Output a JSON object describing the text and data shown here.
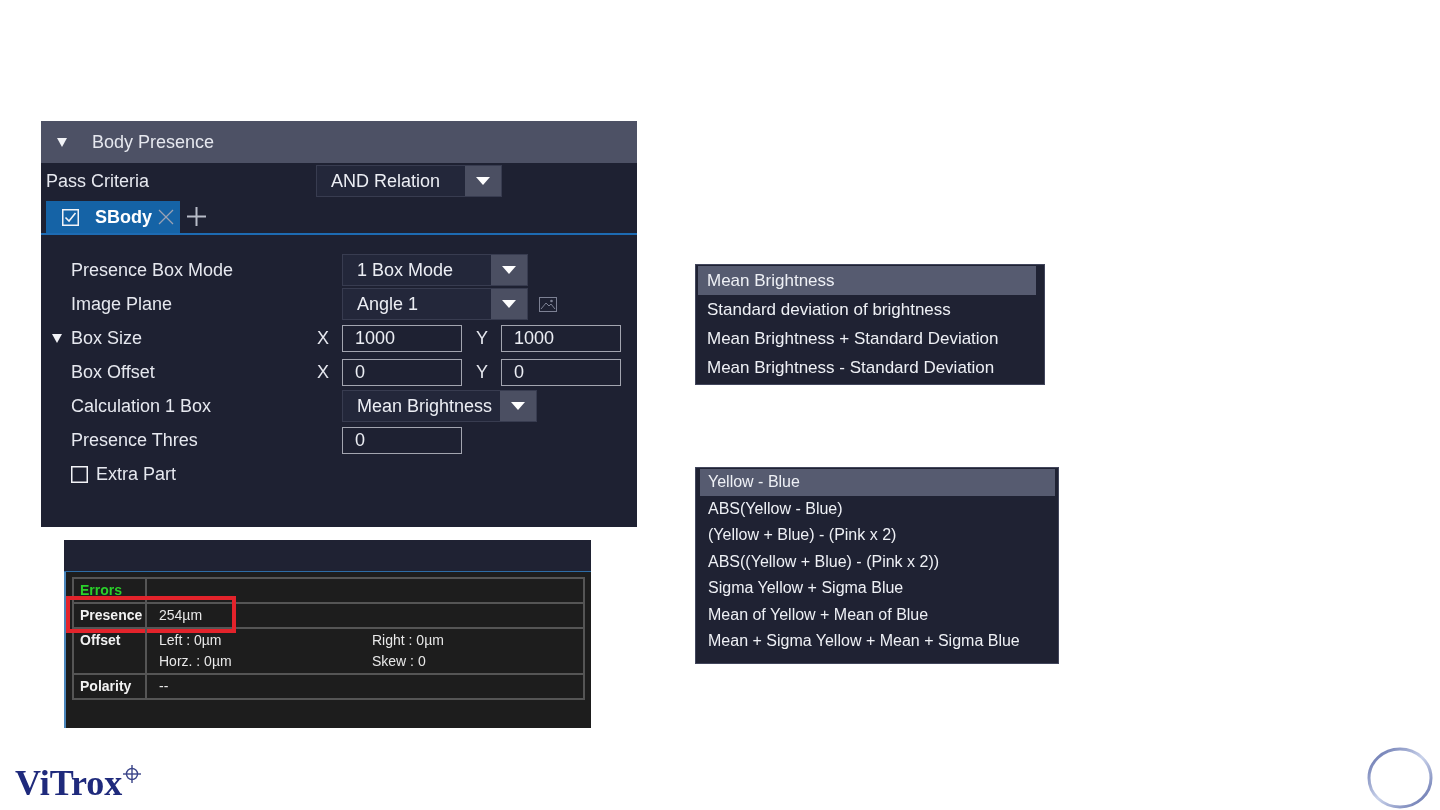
{
  "body_presence": {
    "title": "Body Presence",
    "expanded": true,
    "pass_criteria": {
      "label": "Pass Criteria",
      "value": "AND Relation"
    },
    "tabs": [
      {
        "label": "SBody",
        "checked": true,
        "selected": true
      }
    ],
    "properties": [
      {
        "kind": "dropdown",
        "label": "Presence Box Mode",
        "value": "1 Box Mode"
      },
      {
        "kind": "imagedropdown",
        "label": "Image Plane",
        "value": "Angle 1"
      },
      {
        "kind": "pair",
        "label": "Box Size",
        "expanded": true,
        "fields": [
          {
            "axis": "X",
            "value": "1000"
          },
          {
            "axis": "Y",
            "value": "1000"
          }
        ]
      },
      {
        "kind": "pair",
        "label": "Box Offset",
        "fields": [
          {
            "axis": "X",
            "value": "0"
          },
          {
            "axis": "Y",
            "value": "0"
          }
        ]
      },
      {
        "kind": "dropdown",
        "label": "Calculation 1 Box",
        "value": "Mean Brightness"
      },
      {
        "kind": "input",
        "label": "Presence Thres",
        "value": "0"
      },
      {
        "kind": "checkbox",
        "label": "Extra Part",
        "checked": false
      }
    ]
  },
  "results": {
    "rows": [
      {
        "kind": "error",
        "label": "Errors",
        "highlighted": false
      },
      {
        "kind": "normal",
        "label": "Presence",
        "highlighted": true,
        "values": [
          "254µm"
        ]
      },
      {
        "kind": "normal",
        "label": "Offset",
        "highlighted": false,
        "values": [
          "Left : 0µm",
          "Right : 0µm",
          "Horz. : 0µm",
          "Skew : 0"
        ]
      },
      {
        "kind": "normal",
        "label": "Polarity",
        "highlighted": false,
        "values": [
          "--"
        ]
      }
    ]
  },
  "brightness_menu": {
    "items": [
      {
        "label": "Mean Brightness",
        "selected": true
      },
      {
        "label": "Standard deviation of brightness",
        "selected": false
      },
      {
        "label": "Mean Brightness + Standard Deviation",
        "selected": false
      },
      {
        "label": "Mean Brightness - Standard Deviation",
        "selected": false
      }
    ]
  },
  "color_menu": {
    "items": [
      {
        "label": "Yellow - Blue",
        "selected": true
      },
      {
        "label": "ABS(Yellow - Blue)",
        "selected": false
      },
      {
        "label": "(Yellow + Blue) - (Pink x 2)",
        "selected": false
      },
      {
        "label": "ABS((Yellow + Blue) - (Pink x 2))",
        "selected": false
      },
      {
        "label": "Sigma Yellow + Sigma Blue",
        "selected": false
      },
      {
        "label": "Mean of Yellow + Mean of Blue",
        "selected": false
      },
      {
        "label": "Mean + Sigma Yellow + Mean + Sigma Blue",
        "selected": false
      }
    ]
  },
  "logo": {
    "text": "ViTrox"
  }
}
